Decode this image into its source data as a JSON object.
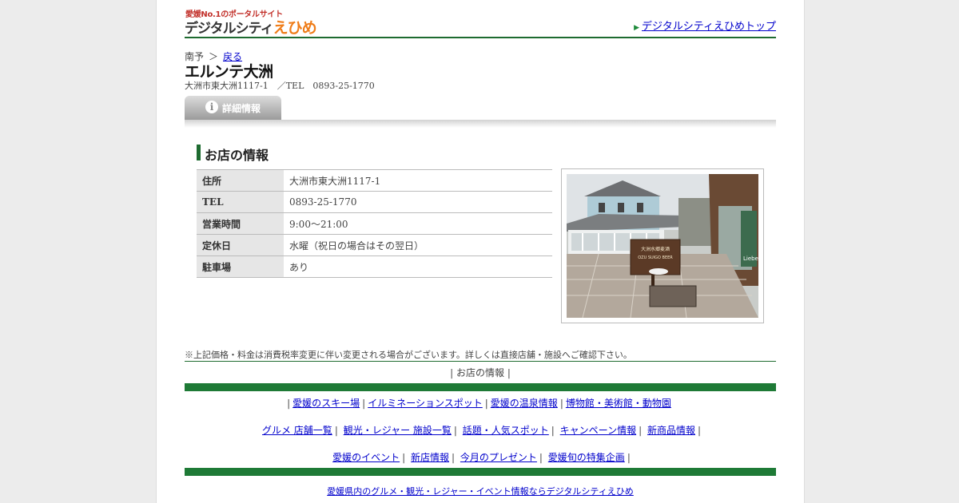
{
  "header": {
    "logo_tagline": "愛媛No.1のポータルサイト",
    "logo_name_main": "デジタルシティ",
    "logo_name_accent": "えひめ",
    "top_link": "デジタルシティえひめトップ"
  },
  "breadcrumb": {
    "region": "南予",
    "separator": "＞",
    "back": "戻る"
  },
  "shop": {
    "name": "エルンテ大洲",
    "address_line": "大洲市東大洲1117-1　／TEL　0893-25-1770"
  },
  "tab": {
    "label": "詳細情報"
  },
  "section": {
    "title": "お店の情報"
  },
  "info_rows": [
    {
      "key": "住所",
      "value": "大洲市東大洲1117-1"
    },
    {
      "key": "TEL",
      "value": "0893-25-1770"
    },
    {
      "key": "営業時間",
      "value": "9:00～21:00"
    },
    {
      "key": "定休日",
      "value": "水曜（祝日の場合はその翌日）"
    },
    {
      "key": "駐車場",
      "value": "あり"
    }
  ],
  "photo": {
    "sign_text_1": "大洲水郷麦酒",
    "sign_text_2": "OZU SUIGO BEER",
    "side_sign": "Liebe"
  },
  "footer": {
    "note": "※上記価格・料金は消費税率変更に伴い変更される場合がございます。詳しくは直接店舗・施設へご確認下さい。",
    "subnav": "お店の情報",
    "row1": [
      "愛媛のスキー場",
      "イルミネーションスポット",
      "愛媛の温泉情報",
      "博物館・美術館・動物園"
    ],
    "row2": [
      "グルメ 店舗一覧",
      "観光・レジャー 施設一覧",
      "話題・人気スポット",
      "キャンペーン情報",
      "新商品情報"
    ],
    "row3": [
      "愛媛のイベント",
      "新店情報",
      "今月のプレゼント",
      "愛媛旬の特集企画"
    ],
    "bottom_link": "愛媛県内のグルメ・観光・レジャー・イベント情報ならデジタルシティえひめ"
  },
  "colors": {
    "brand_green": "#1e6b30",
    "logo_orange": "#ef7d1a",
    "logo_red": "#c2302a"
  }
}
